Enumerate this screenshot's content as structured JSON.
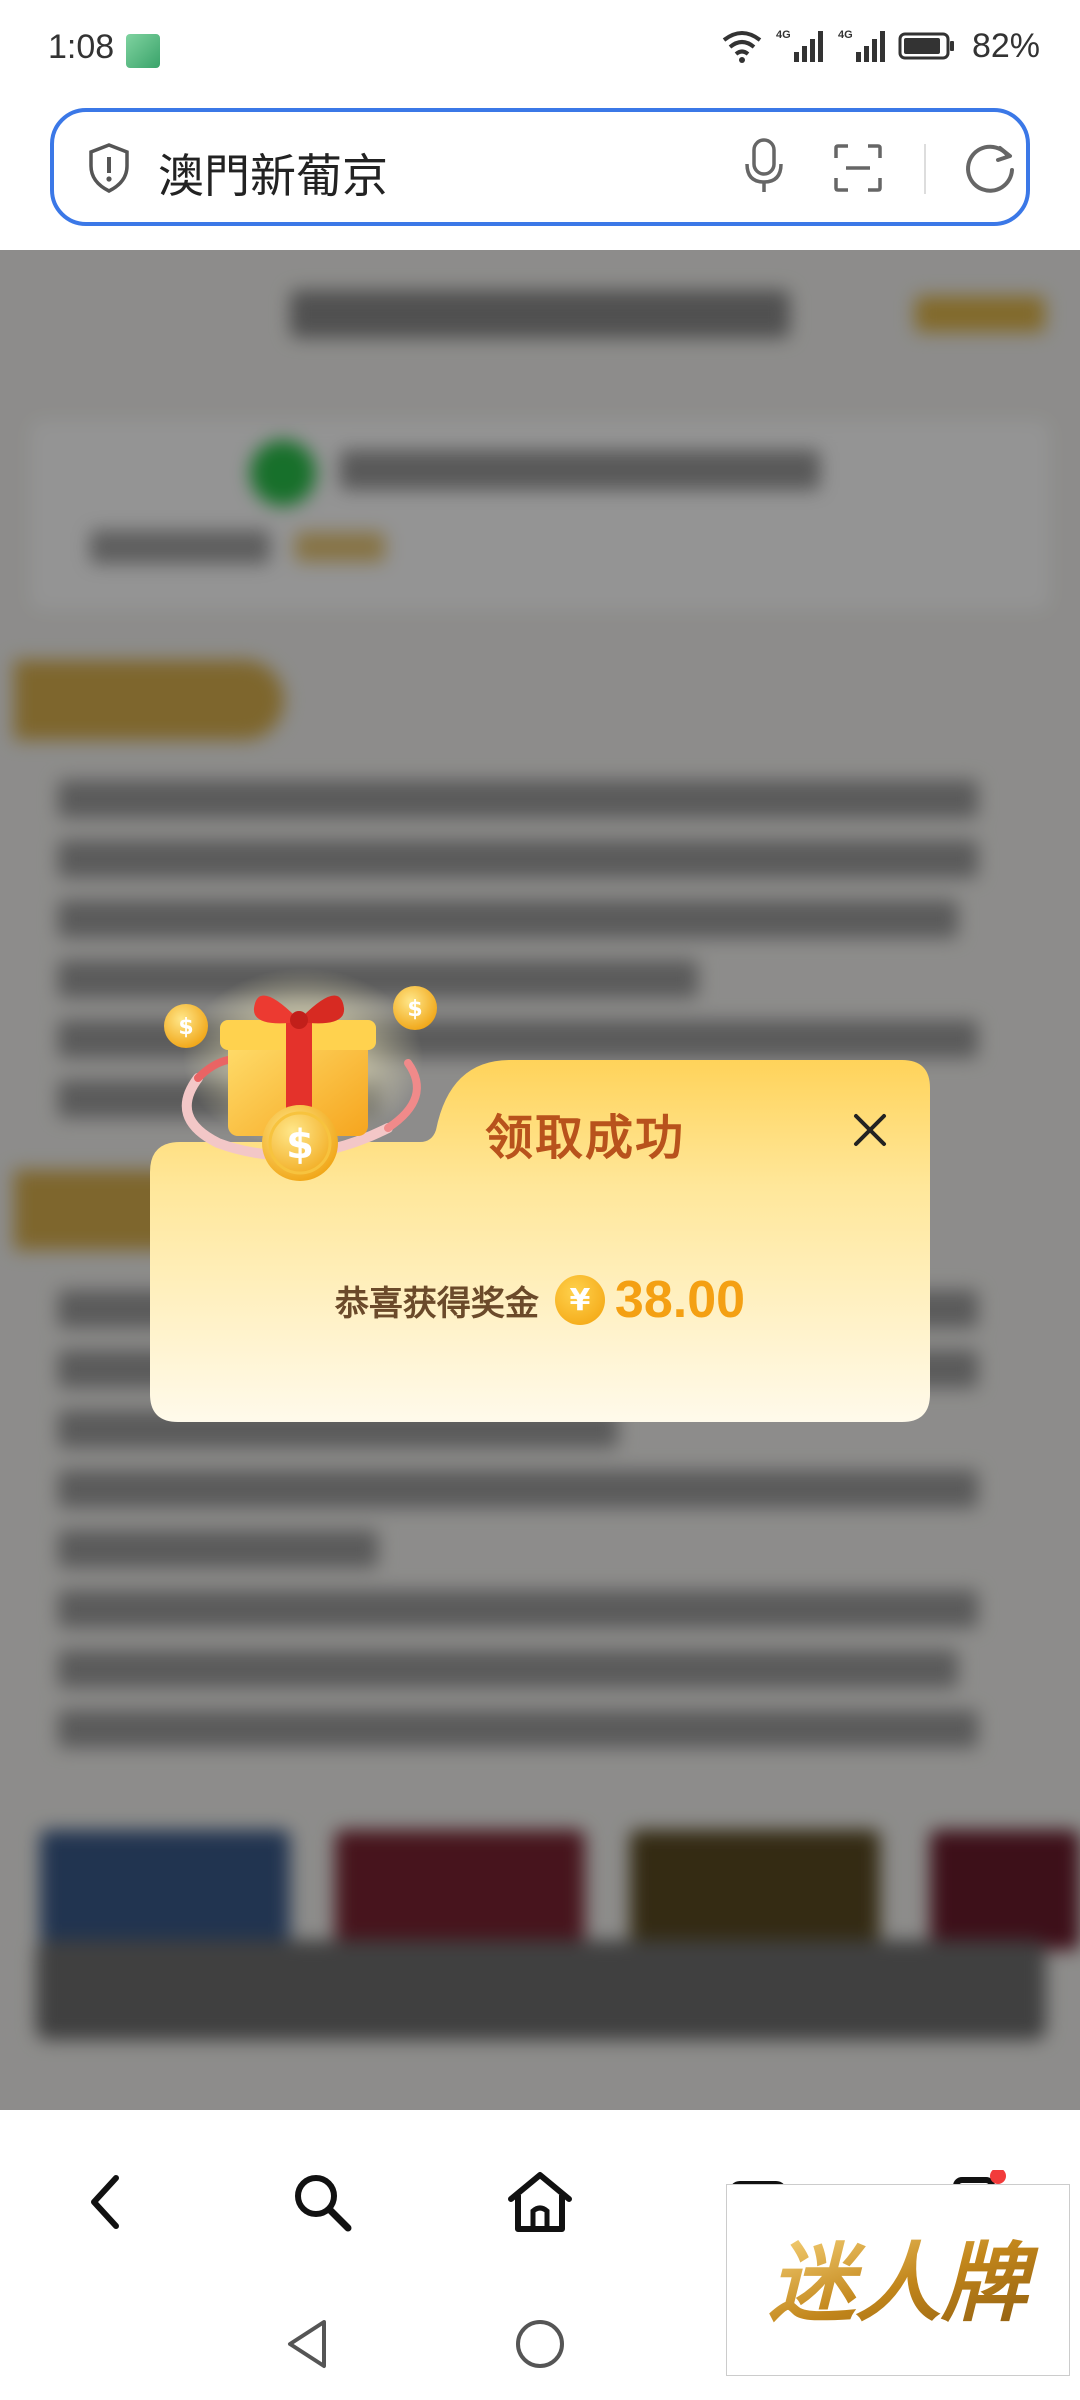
{
  "status_bar": {
    "time": "1:08",
    "signal_1_label": "4G",
    "signal_2_label": "4G",
    "battery": "82%"
  },
  "search_bar": {
    "query": "澳門新葡京"
  },
  "dialog": {
    "title": "领取成功",
    "reward_label": "恭喜获得奖金",
    "currency_symbol": "¥",
    "amount": "38.00"
  },
  "bottom_nav": {
    "items": [
      "back-icon",
      "search-icon",
      "home-icon",
      "tabs-icon",
      "menu-icon"
    ]
  },
  "watermark": {
    "text": "迷人牌"
  }
}
